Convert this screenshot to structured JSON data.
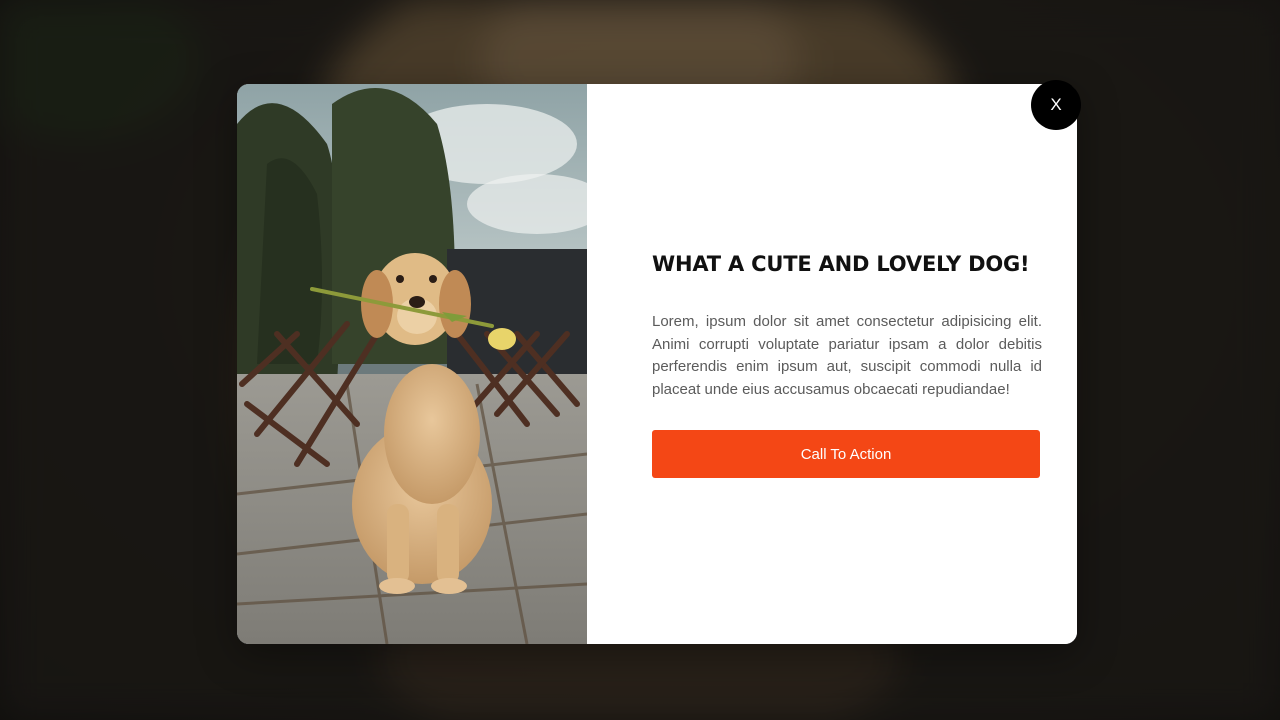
{
  "colors": {
    "cta_background": "#f44715",
    "close_background": "#000000",
    "modal_background": "#ffffff",
    "title_color": "#111111",
    "body_text_color": "#5b5b5b"
  },
  "modal": {
    "close_label": "X",
    "image_subject": "golden retriever puppy holding a yellow tulip",
    "title": "WHAT A CUTE AND LOVELY DOG!",
    "description": "Lorem, ipsum dolor sit amet consectetur adipisicing elit. Animi corrupti voluptate pariatur ipsam a dolor debitis perferendis enim ipsum aut, suscipit commodi nulla id placeat unde eius accusamus obcaecati repudiandae!",
    "cta_label": "Call To Action"
  }
}
